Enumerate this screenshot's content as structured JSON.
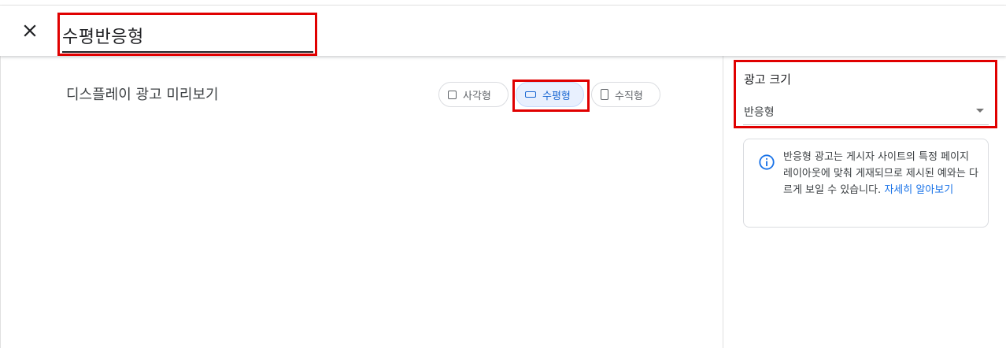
{
  "header": {
    "close_icon": "close-icon",
    "title_value": "수평반응형"
  },
  "preview": {
    "title": "디스플레이 광고 미리보기",
    "chips": [
      {
        "label": "사각형",
        "icon": "square-icon",
        "selected": false
      },
      {
        "label": "수평형",
        "icon": "horizontal-rect-icon",
        "selected": true
      },
      {
        "label": "수직형",
        "icon": "vertical-rect-icon",
        "selected": false
      }
    ]
  },
  "sidebar": {
    "size_label": "광고 크기",
    "size_value": "반응형",
    "info": {
      "icon": "info-icon",
      "text": "반응형 광고는 게시자 사이트의 특정 페이지 레이아웃에 맞춰 게재되므로 제시된 예와는 다르게 보일 수 있습니다. ",
      "link": "자세히 알아보기"
    }
  },
  "colors": {
    "accent": "#1a73e8",
    "selected_chip_bg": "#e8f0fe",
    "highlight_red": "#e00000"
  }
}
